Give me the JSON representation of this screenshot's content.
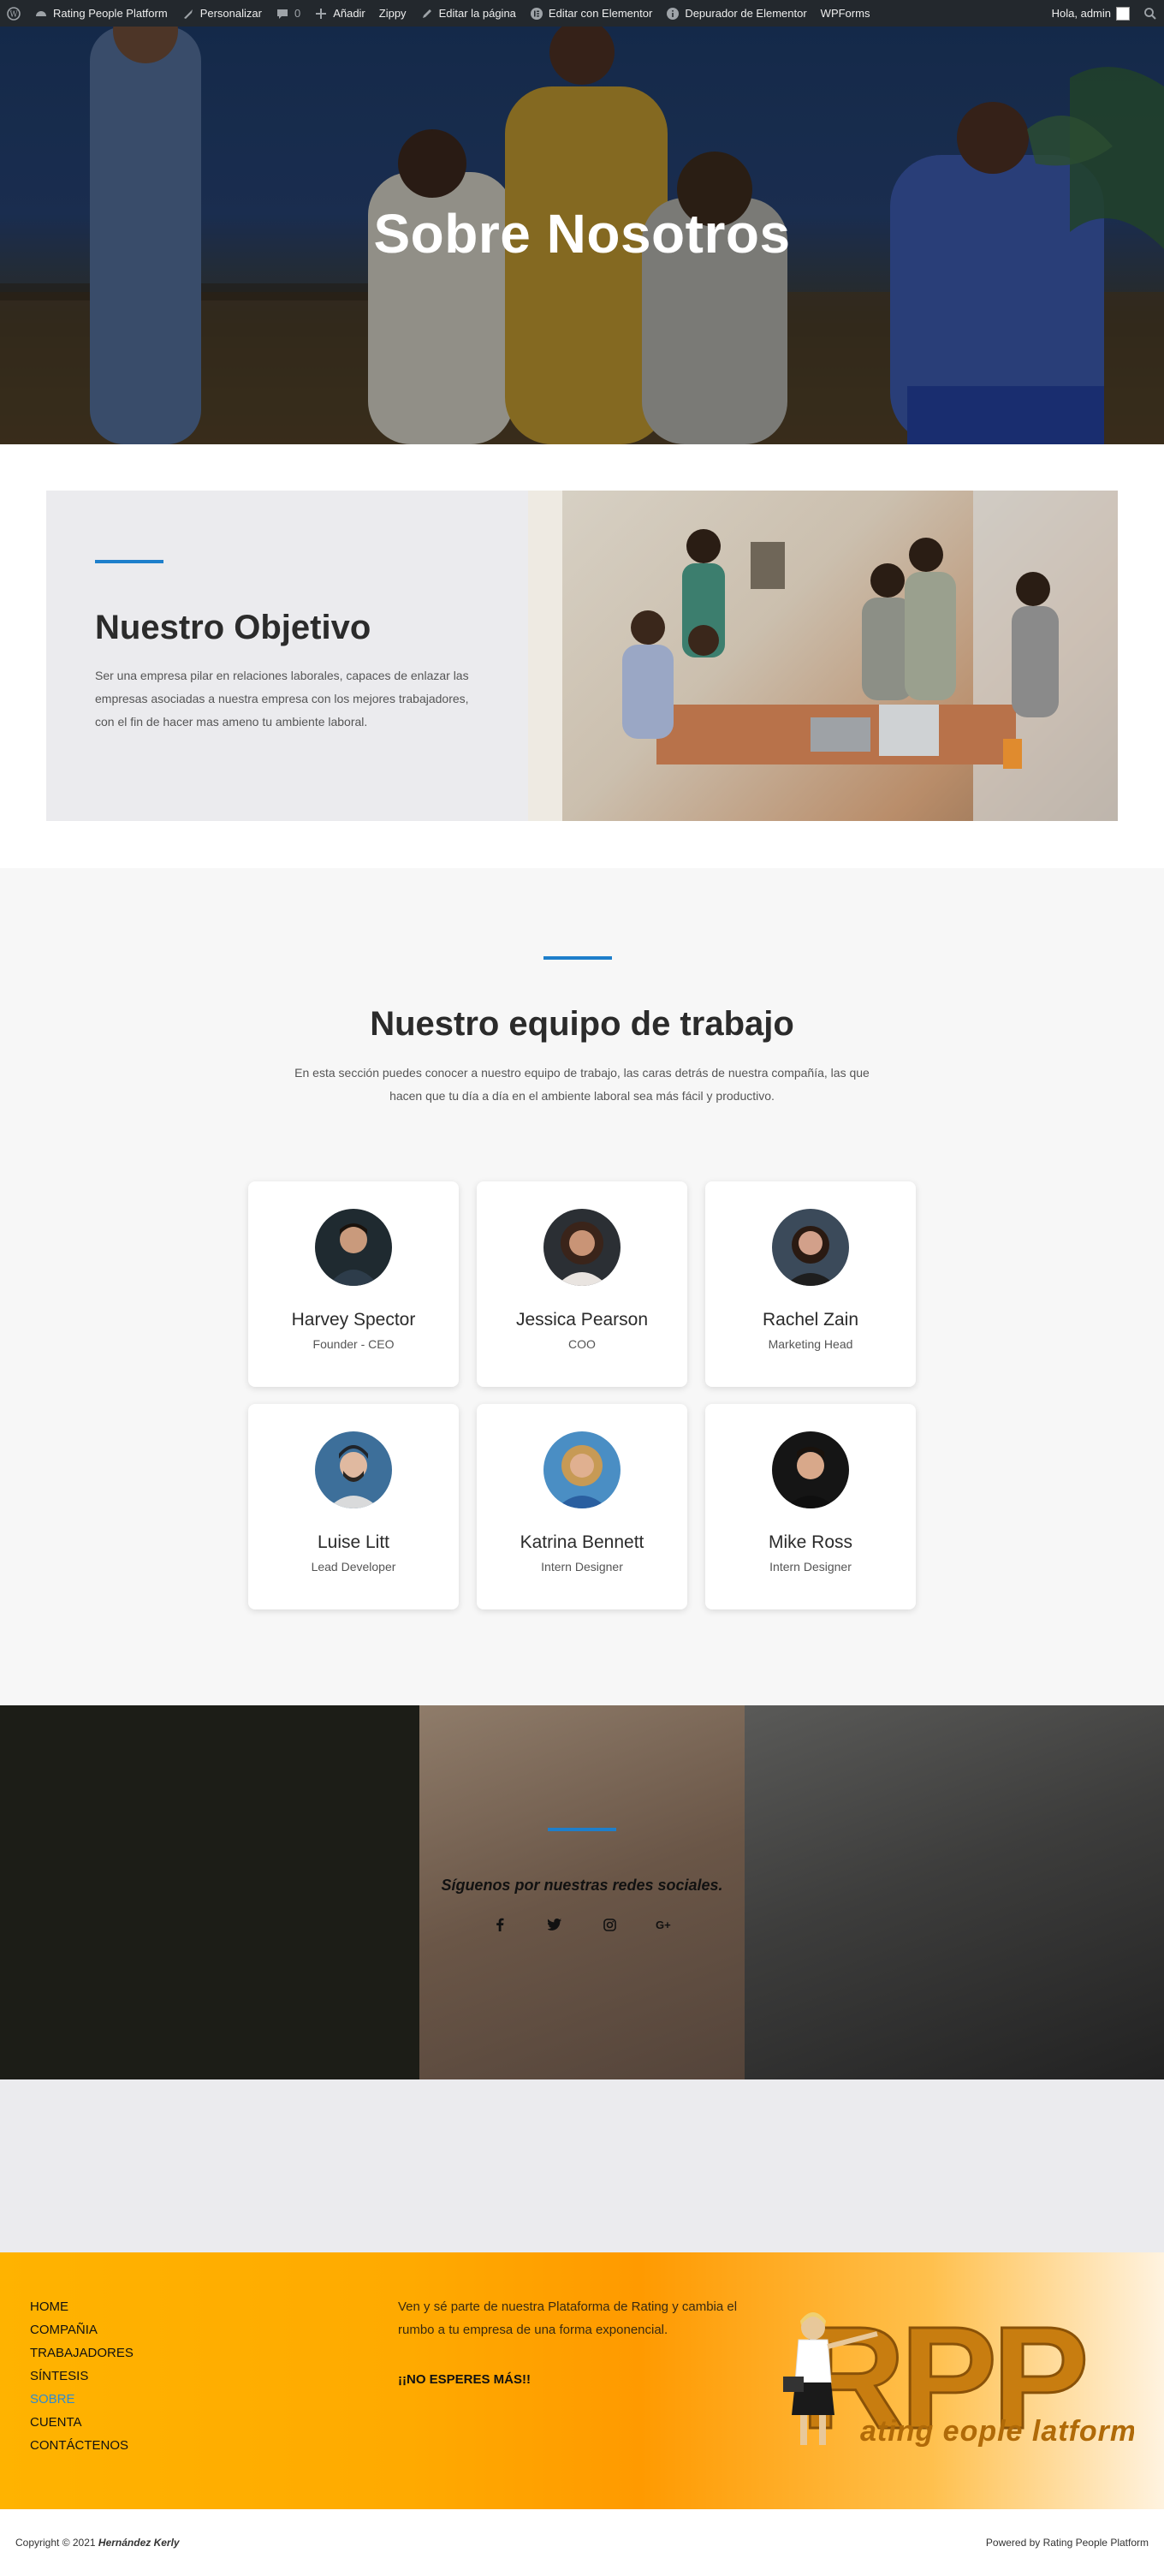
{
  "admin_bar": {
    "site": "Rating People Platform",
    "customize": "Personalizar",
    "comments": "0",
    "add": "Añadir",
    "zippy": "Zippy",
    "edit_page": "Editar la página",
    "edit_elementor": "Editar con Elementor",
    "debugger": "Depurador de Elementor",
    "wpforms": "WPForms",
    "greeting": "Hola, admin"
  },
  "hero": {
    "title": "Sobre Nosotros"
  },
  "objective": {
    "title": "Nuestro Objetivo",
    "text": "Ser una empresa pilar en relaciones laborales, capaces de enlazar las empresas asociadas a nuestra empresa con los mejores trabajadores, con el fin de hacer mas ameno tu ambiente laboral."
  },
  "team": {
    "title": "Nuestro equipo de trabajo",
    "subtitle": "En esta sección puedes conocer a nuestro equipo de trabajo, las caras detrás de nuestra compañía, las que hacen que tu día a día en el ambiente laboral sea más fácil y productivo.",
    "members": [
      {
        "name": "Harvey Spector",
        "role": "Founder - CEO"
      },
      {
        "name": "Jessica Pearson",
        "role": "COO"
      },
      {
        "name": "Rachel Zain",
        "role": "Marketing Head"
      },
      {
        "name": "Luise Litt",
        "role": "Lead Developer"
      },
      {
        "name": "Katrina Bennett",
        "role": "Intern Designer"
      },
      {
        "name": "Mike Ross",
        "role": "Intern Designer"
      }
    ]
  },
  "social": {
    "text": "Síguenos por nuestras redes sociales.",
    "icons": [
      "facebook-icon",
      "twitter-icon",
      "instagram-icon",
      "google-plus-icon"
    ]
  },
  "footer": {
    "nav": [
      "HOME",
      "COMPAÑIA",
      "TRABAJADORES",
      "SÍNTESIS",
      "SOBRE",
      "CUENTA",
      "CONTÁCTENOS"
    ],
    "text": "Ven y sé parte de nuestra Plataforma de Rating y cambia el rumbo a tu empresa de una forma exponencial.",
    "cta": "¡¡NO ESPERES MÁS!!",
    "logo_text": "Rating People Platform",
    "copyright_prefix": "Copyright © 2021",
    "copyright_author": "Hernández Kerly",
    "powered": "Powered by Rating People Platform"
  }
}
